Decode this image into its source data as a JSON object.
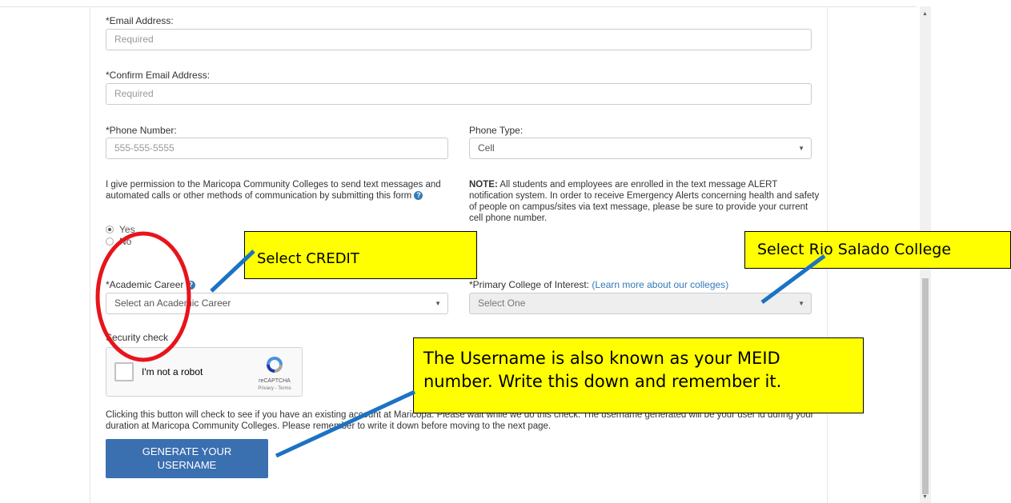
{
  "form": {
    "email": {
      "label": "*Email Address:",
      "placeholder": "Required"
    },
    "confirm_email": {
      "label": "*Confirm Email Address:",
      "placeholder": "Required"
    },
    "phone": {
      "label": "*Phone Number:",
      "placeholder": "555-555-5555"
    },
    "phone_type": {
      "label": "Phone Type:",
      "value": "Cell"
    },
    "permission": {
      "text": "I give permission to the Maricopa Community Colleges to send text messages and automated calls or other methods of communication by submitting this form",
      "options": [
        "Yes",
        "No"
      ],
      "selected": "Yes"
    },
    "note": {
      "bold": "NOTE:",
      "text": " All students and employees are enrolled in the text message ALERT notification system. In order to receive Emergency Alerts concerning health and safety of people on campus/sites via text message, please be sure to provide your current cell phone number."
    },
    "academic_career": {
      "label": "*Academic Career",
      "value": "Select an Academic Career"
    },
    "primary_college": {
      "label": "*Primary College of Interest: ",
      "link_open": "(",
      "link": "Learn more about our colleges",
      "link_close": ")",
      "value": "Select One"
    },
    "security": {
      "label": "Security check",
      "checkbox_text": "I'm not a robot",
      "brand": "reCAPTCHA",
      "terms": "Privacy - Terms"
    },
    "info_text": "Clicking this button will check to see if you have an existing account at Maricopa. Please wait while we do this check. The username generated will be your user id during your duration at Maricopa Community Colleges. Please remember to write it down before moving to the next page.",
    "generate_button": [
      "GENERATE YOUR",
      "USERNAME"
    ]
  },
  "annotations": {
    "credit": "Select CREDIT",
    "rio": "Select Rio Salado College",
    "username_line1": "The Username is also known as your MEID",
    "username_line2": "number.  Write this down and remember it."
  },
  "colors": {
    "callout_fill": "#ffff00",
    "circle": "#e8141b",
    "pointer_line": "#1c72c4",
    "button": "#3a6fb0",
    "link": "#337ab7"
  },
  "icons": {
    "help": "question-circle-icon",
    "dropdown": "caret-down-icon",
    "recaptcha": "recaptcha-logo-icon"
  }
}
